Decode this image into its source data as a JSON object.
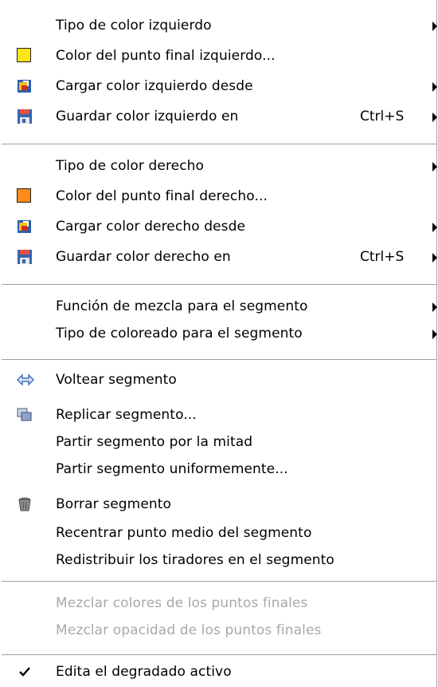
{
  "menu": {
    "left_type": "Tipo de color izquierdo",
    "left_endpoint": "Color del punto final izquierdo...",
    "load_left": "Cargar color izquierdo desde",
    "save_left": "Guardar color izquierdo en",
    "save_left_shortcut": "Ctrl+S",
    "right_type": "Tipo de color derecho",
    "right_endpoint": "Color del punto final derecho...",
    "load_right": "Cargar color derecho desde",
    "save_right": "Guardar color derecho en",
    "save_right_shortcut": "Ctrl+S",
    "blend_function": "Función de mezcla para el segmento",
    "coloring_type": "Tipo de coloreado para el segmento",
    "flip": "Voltear segmento",
    "replicate": "Replicar segmento...",
    "split_midpoint": "Partir segmento por la mitad",
    "split_uniform": "Partir segmento uniformemente...",
    "delete": "Borrar segmento",
    "recenter": "Recentrar punto medio del segmento",
    "redistribute": "Redistribuir los tiradores en el segmento",
    "blend_colors": "Mezclar colores de los puntos finales",
    "blend_opacity": "Mezclar opacidad de los puntos finales",
    "edit_active": "Edita el degradado activo"
  },
  "colors": {
    "left_swatch": "#ffe51a",
    "right_swatch": "#ff8c1a",
    "disabled_text": "#a8a8a8",
    "separator": "#a0a0a0"
  },
  "icons": {
    "load": "load-color-icon",
    "save": "save-color-icon",
    "flip": "flip-arrows-icon",
    "replicate": "replicate-icon",
    "delete": "trash-icon",
    "check": "checkmark-icon",
    "submenu": "submenu-arrow-icon"
  }
}
